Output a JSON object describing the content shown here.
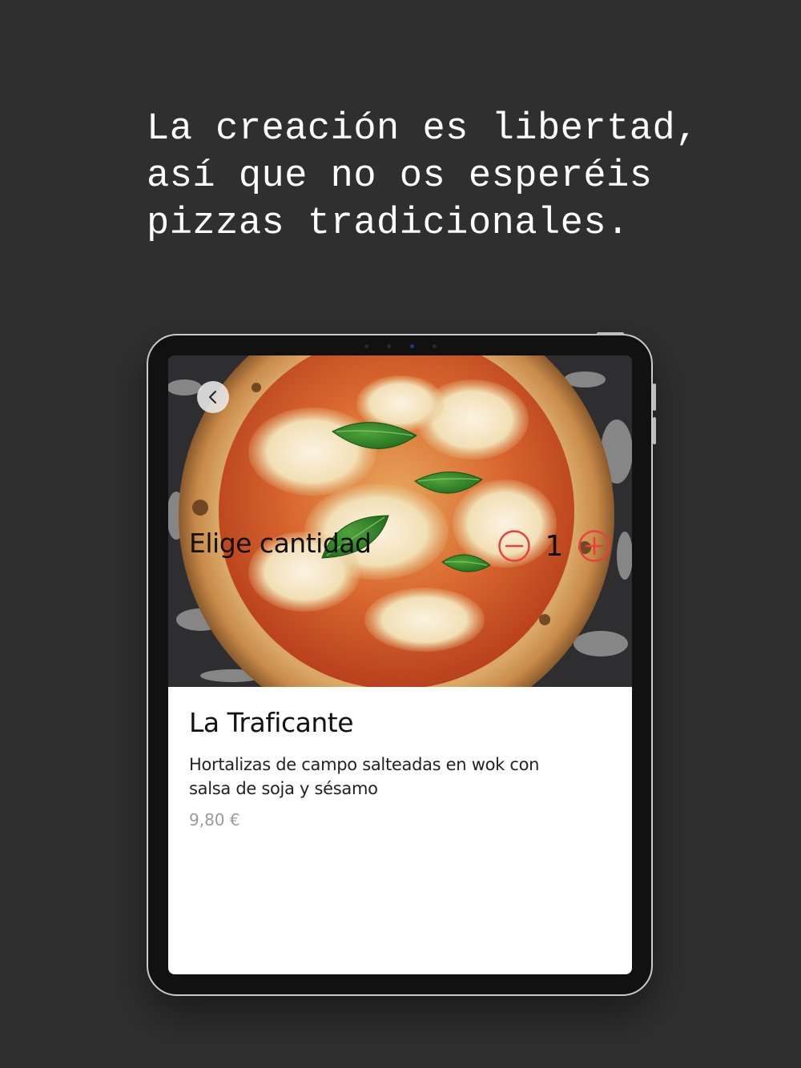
{
  "headline": "La creación es libertad, así que no os esperéis pizzas tradicionales.",
  "product": {
    "title": "La Traficante",
    "description": "Hortalizas de campo salteadas en wok con salsa de soja y sésamo",
    "price": "9,80 €"
  },
  "quantity": {
    "label": "Elige cantidad",
    "value": "1"
  },
  "icons": {
    "back": "chevron-left-icon",
    "minus": "minus-circle-icon",
    "plus": "plus-circle-icon"
  },
  "colors": {
    "background": "#2f2f2f",
    "accent": "#e8413c",
    "price": "#9a9a9a"
  }
}
